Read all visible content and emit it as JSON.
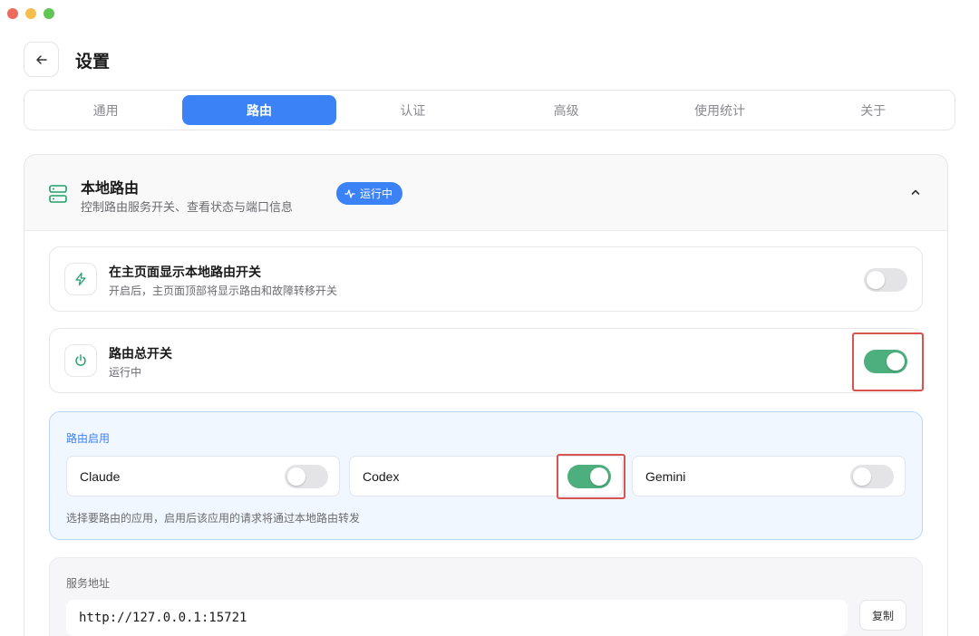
{
  "window": {
    "title": "设置"
  },
  "header": {
    "title": "设置"
  },
  "tabs": [
    {
      "label": "通用",
      "active": false
    },
    {
      "label": "路由",
      "active": true
    },
    {
      "label": "认证",
      "active": false
    },
    {
      "label": "高级",
      "active": false
    },
    {
      "label": "使用统计",
      "active": false
    },
    {
      "label": "关于",
      "active": false
    }
  ],
  "panel": {
    "title": "本地路由",
    "subtitle": "控制路由服务开关、查看状态与端口信息",
    "badge": "运行中",
    "icon": "server-icon",
    "collapse_icon": "chevron-up-icon"
  },
  "show_toggle": {
    "title": "在主页面显示本地路由开关",
    "subtitle": "开启后，主页面顶部将显示路由和故障转移开关",
    "icon": "lightning-icon",
    "enabled": false
  },
  "master_switch": {
    "title": "路由总开关",
    "subtitle": "运行中",
    "icon": "power-icon",
    "enabled": true
  },
  "routing_enable": {
    "title": "路由启用",
    "apps": [
      {
        "name": "Claude",
        "enabled": false
      },
      {
        "name": "Codex",
        "enabled": true
      },
      {
        "name": "Gemini",
        "enabled": false
      }
    ],
    "hint": "选择要路由的应用，启用后该应用的请求将通过本地路由转发"
  },
  "service": {
    "title": "服务地址",
    "address": "http://127.0.0.1:15721",
    "copy_label": "复制"
  },
  "colors": {
    "accent": "#3b82f6",
    "toggle_on": "#4caf7d",
    "highlight": "#d9534f"
  }
}
